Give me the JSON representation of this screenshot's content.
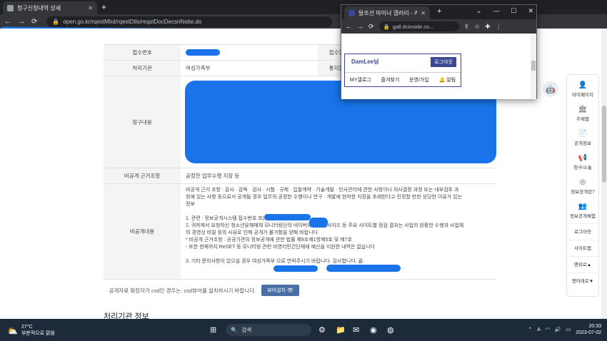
{
  "browser": {
    "tab_title": "청구신청내역 상세",
    "url": "open.go.kr/rqestMlrd/rqestDtls/reqstDocDecsnNotie.do"
  },
  "detail": {
    "rows": [
      {
        "label": "접수번호",
        "value": "",
        "label2": "접수일자",
        "value2": ""
      },
      {
        "label": "처리기관",
        "value": "여성가족부",
        "label2": "통지일자",
        "value2": ""
      }
    ],
    "request_label": "청구내용",
    "reason_label": "비공개 근거조항",
    "reason_value": "공정한 업무수행 지장 등",
    "nondisclosure_label": "비공개내용",
    "nondisclosure_lines": [
      "비공개 근거 조항 : 감사 · 감독 · 검사 · 시험 · 규제 · 입찰계약 · 기술개발 · 인사관리에 관한 사항이나 의사결정 과정 또는 내부검토 과",
      "정에 있는 사항 등으로서 공개될 경우 업무의 공정한 수행이나 연구 · 개발에 현저한 지장을 초래한다고 인정할 만한 상당한 이유가 있는",
      "정보",
      "",
      "1. 관련 : 정보공개시스템 접수번호                  호(2023",
      "2. 귀하께서 요청하신 청소년유해매체 모니터링단의 네이버와 디씨인사이드 등 주요 사이트별 점검 결과는 사업의 원활한 수행과 사업체",
      "의 경영상 비밀 등의 사유로 인해 공개가 불가함을 양해 바랍니다.",
      "* 비공개 근거조항 : 공공기관의 정보공개에 관한 법률 제9조제1항제5호 및 제7호",
      "- 또한 현재까지 ReSET 등 모니터링 관련 비영리민간단체에 예산을 지원한 내역은 없습니다",
      "",
      "3. 기타 문의사항이 있으실 경우 여성가족부                                            으로 연락주시기 바랍니다. 감사합니다. 끝."
    ]
  },
  "note": {
    "text": "· 공개자료 확장자가 csd인 경우는, csd뷰어를 설치하시기 바랍니다.",
    "button": "뷰어설치"
  },
  "section_title": "처리기관 정보",
  "sidepanel": {
    "items": [
      {
        "icon": "person-icon",
        "label": "마이페이지"
      },
      {
        "icon": "building-icon",
        "label": "주제별"
      },
      {
        "icon": "document-icon",
        "label": "공개정보"
      },
      {
        "icon": "megaphone-icon",
        "label": "청구/소통"
      },
      {
        "icon": "question-icon",
        "label": "정보공개란?"
      },
      {
        "icon": "people-icon",
        "label": "정보공개체험"
      }
    ],
    "buttons": [
      "로그아웃",
      "사이트맵",
      "맨위로▲",
      "맨아래로▼"
    ]
  },
  "popup": {
    "tab_title": "탈조선 마이너 갤러리 - 커뮤",
    "url": "gall.dcinside.co...",
    "logo": "DamLee님",
    "logout": "로그아웃",
    "nav": [
      "MY갤로그",
      "즐겨찾기",
      "운영/가입",
      "알림"
    ]
  },
  "taskbar": {
    "temperature": "27°C",
    "weather": "부분적으로 맑음",
    "search": "검색",
    "time": "20:33",
    "date": "2023-07-02",
    "lang": "A"
  },
  "colors": {
    "redaction": "#1a73e8",
    "accent": "#4a6fa5",
    "popup_brand": "#3b4890"
  }
}
